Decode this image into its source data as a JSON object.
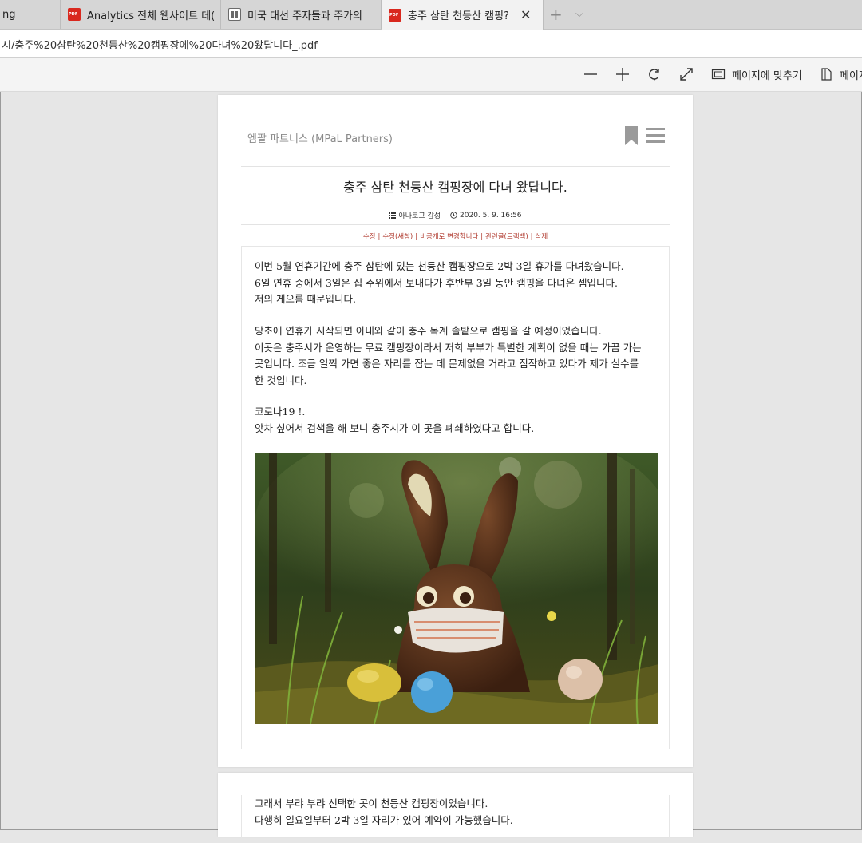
{
  "tabs": [
    {
      "label": "ng",
      "icon": "none",
      "active": false
    },
    {
      "label": "Analytics 전체 웹사이트 데(",
      "icon": "pdf-icon",
      "active": false
    },
    {
      "label": "미국 대선 주자들과 주가의",
      "icon": "document-icon",
      "active": false
    },
    {
      "label": "충주 삼탄 천등산 캠핑?",
      "icon": "pdf-icon",
      "active": true
    }
  ],
  "tab_controls": {
    "new_tab": "+",
    "tab_menu": "⌵",
    "close": "✕"
  },
  "address": {
    "url": "시/충주%20삼탄%20천등산%20캠핑장에%20다녀%20왔답니다_.pdf"
  },
  "toolbar": {
    "zoom_out": "—",
    "zoom_in": "+",
    "fit_to_page": "페이지에 맞추기",
    "page_view": "페이지"
  },
  "blog": {
    "name": "엠팔 파트너스 (MPaL Partners)",
    "post_title": "충주 삼탄 천등산 캠핑장에 다녀 왔답니다.",
    "category": "아나로그 감성",
    "date": "2020. 5. 9. 16:56",
    "admin_links": [
      "수정",
      "수정(새창)",
      "비공개로 변경합니다",
      "관련글(트랙백)",
      "삭제"
    ],
    "paragraph1": [
      "이번 5월 연휴기간에 충주 삼탄에 있는 천등산 캠핑장으로 2박 3일 휴가를 다녀왔습니다.",
      "6일 연휴 중에서 3일은 집 주위에서 보내다가 후반부 3일 동안 캠핑을 다녀온 셈입니다.",
      "저의 게으름 때문입니다."
    ],
    "paragraph2": [
      "당초에 연휴가 시작되면 아내와 같이 충주 목계 솔밭으로 캠핑을 갈 예정이었습니다.",
      "이곳은 충주시가 운영하는 무료 캠핑장이라서 저희 부부가 특별한 계획이 없을 때는 가끔 가는",
      "곳입니다.  조금 일찍 가면 좋은 자리를 잡는 데 문제없을 거라고 짐작하고 있다가 제가 실수를",
      "한 것입니다."
    ],
    "paragraph3": [
      "코로나19 !.",
      "앗차 싶어서 검색을 해 보니 충주시가 이 곳을 폐쇄하였다고 합니다."
    ],
    "page2_paragraph": [
      "그래서 부랴 부랴 선택한 곳이 천등산 캠핑장이었습니다.",
      "다행히 일요일부터 2박 3일 자리가 있어 예약이 가능했습니다."
    ]
  },
  "colors": {
    "accent_link": "#b03a2e",
    "tab_strip": "#d6d6d6",
    "viewer_bg": "#e6e6e6"
  }
}
